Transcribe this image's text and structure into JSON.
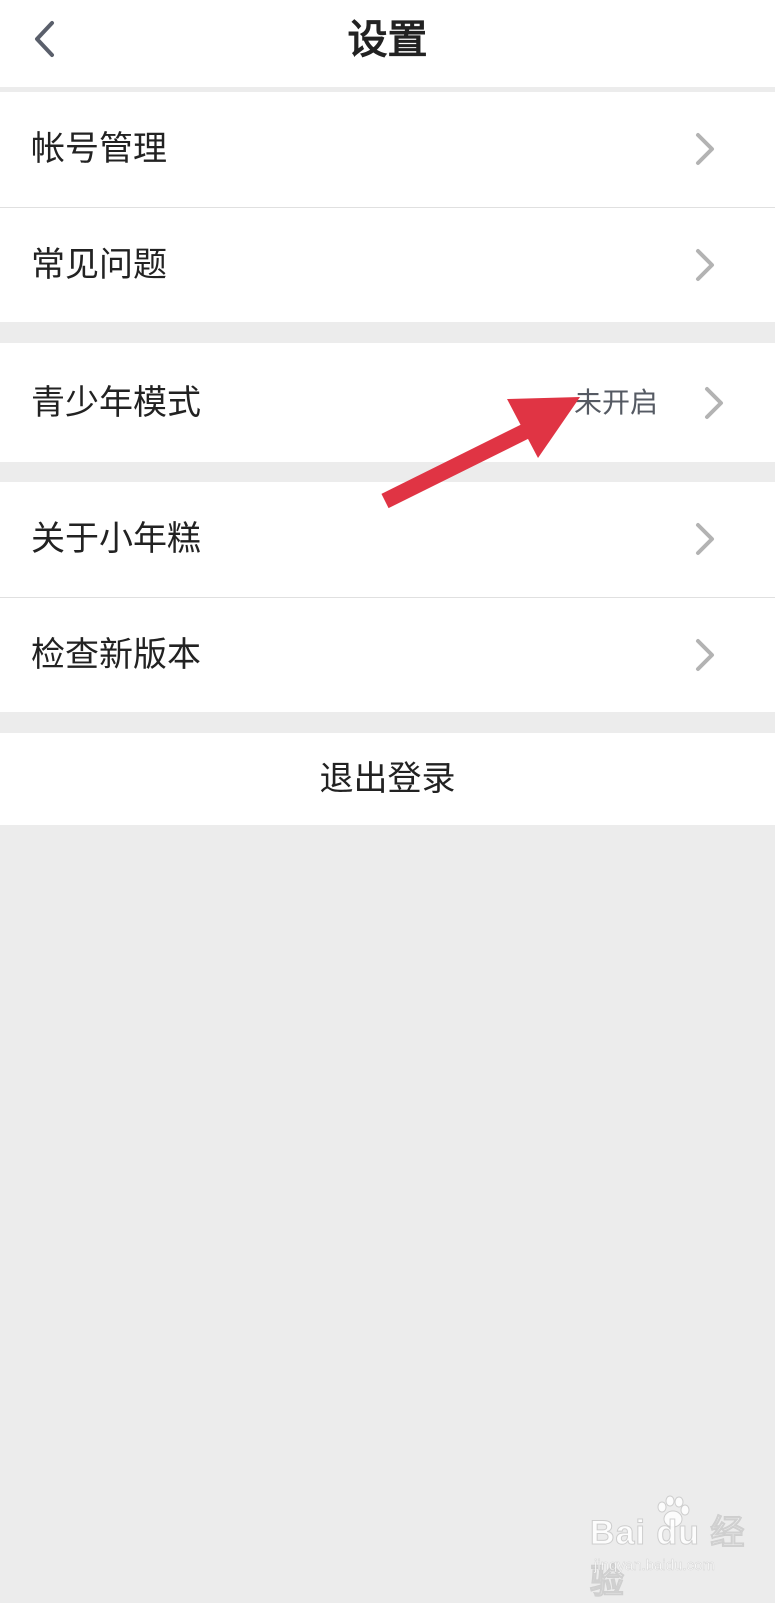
{
  "header": {
    "title": "设置",
    "back_icon": "chevron-left-icon"
  },
  "settings": {
    "group1": [
      {
        "label": "帐号管理",
        "icon": "chevron-right-icon"
      },
      {
        "label": "常见问题",
        "icon": "chevron-right-icon"
      }
    ],
    "group2": [
      {
        "label": "青少年模式",
        "value": "未开启",
        "icon": "chevron-right-icon"
      }
    ],
    "group3": [
      {
        "label": "关于小年糕",
        "icon": "chevron-right-icon"
      },
      {
        "label": "检查新版本",
        "icon": "chevron-right-icon"
      }
    ]
  },
  "logout": {
    "label": "退出登录"
  },
  "annotation": {
    "arrow_color": "#e03444"
  },
  "watermark": {
    "brand": "Bai du 经验",
    "domain": "jingyan.baidu.com"
  },
  "colors": {
    "background": "#ececec",
    "row_background": "#ffffff",
    "chevron": "#b3b3b3",
    "text": "#222222"
  }
}
